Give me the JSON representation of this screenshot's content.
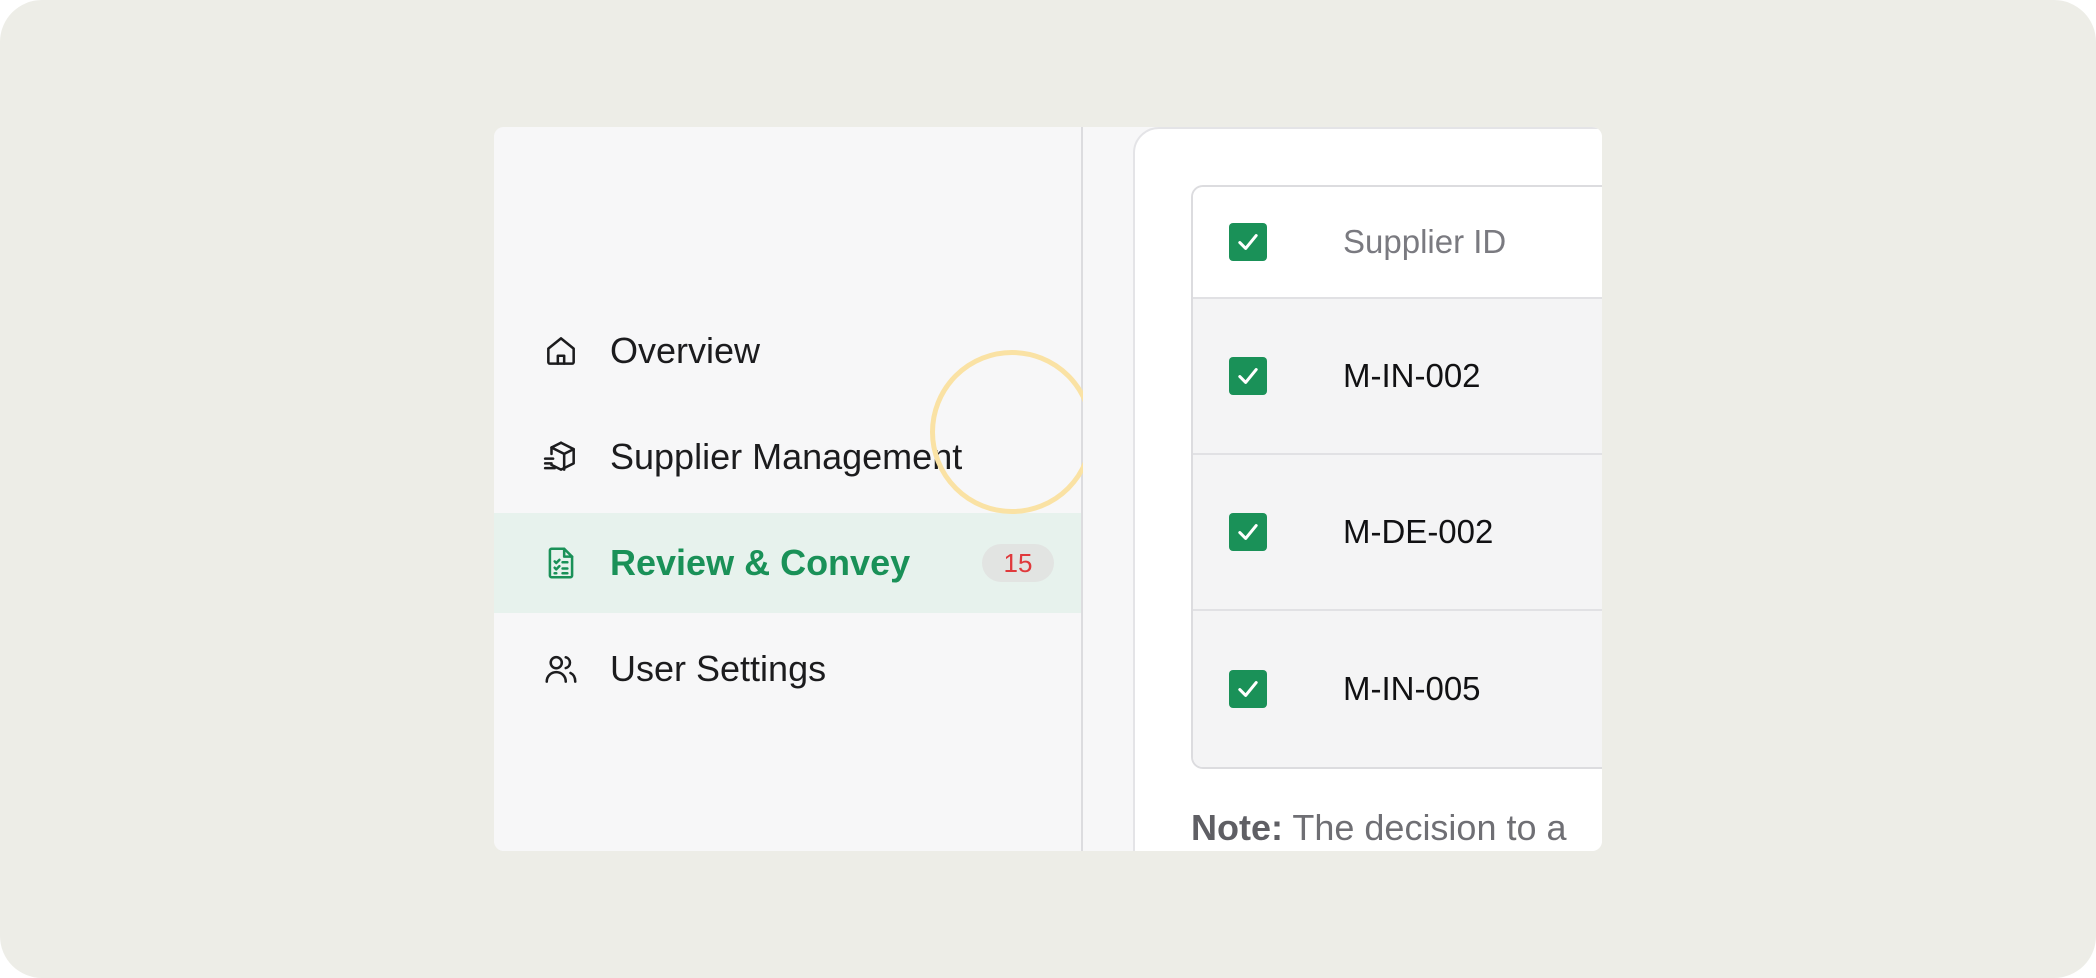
{
  "sidebar": {
    "items": [
      {
        "label": "Overview",
        "icon": "home-icon"
      },
      {
        "label": "Supplier Management",
        "icon": "package-icon"
      },
      {
        "label": "Review & Convey",
        "icon": "checklist-icon",
        "badge": "15",
        "active": true
      },
      {
        "label": "User Settings",
        "icon": "users-icon"
      }
    ]
  },
  "table": {
    "header": {
      "column": "Supplier ID",
      "checked": true
    },
    "rows": [
      {
        "supplier_id": "M-IN-002",
        "checked": true
      },
      {
        "supplier_id": "M-DE-002",
        "checked": true
      },
      {
        "supplier_id": "M-IN-005",
        "checked": true
      }
    ]
  },
  "note": {
    "label": "Note:",
    "text": "The decision to a"
  },
  "colors": {
    "accent": "#1a9158",
    "active_bg": "#e7f2ed",
    "badge_text": "#e0393c",
    "highlight_ring": "#fae2a4"
  }
}
